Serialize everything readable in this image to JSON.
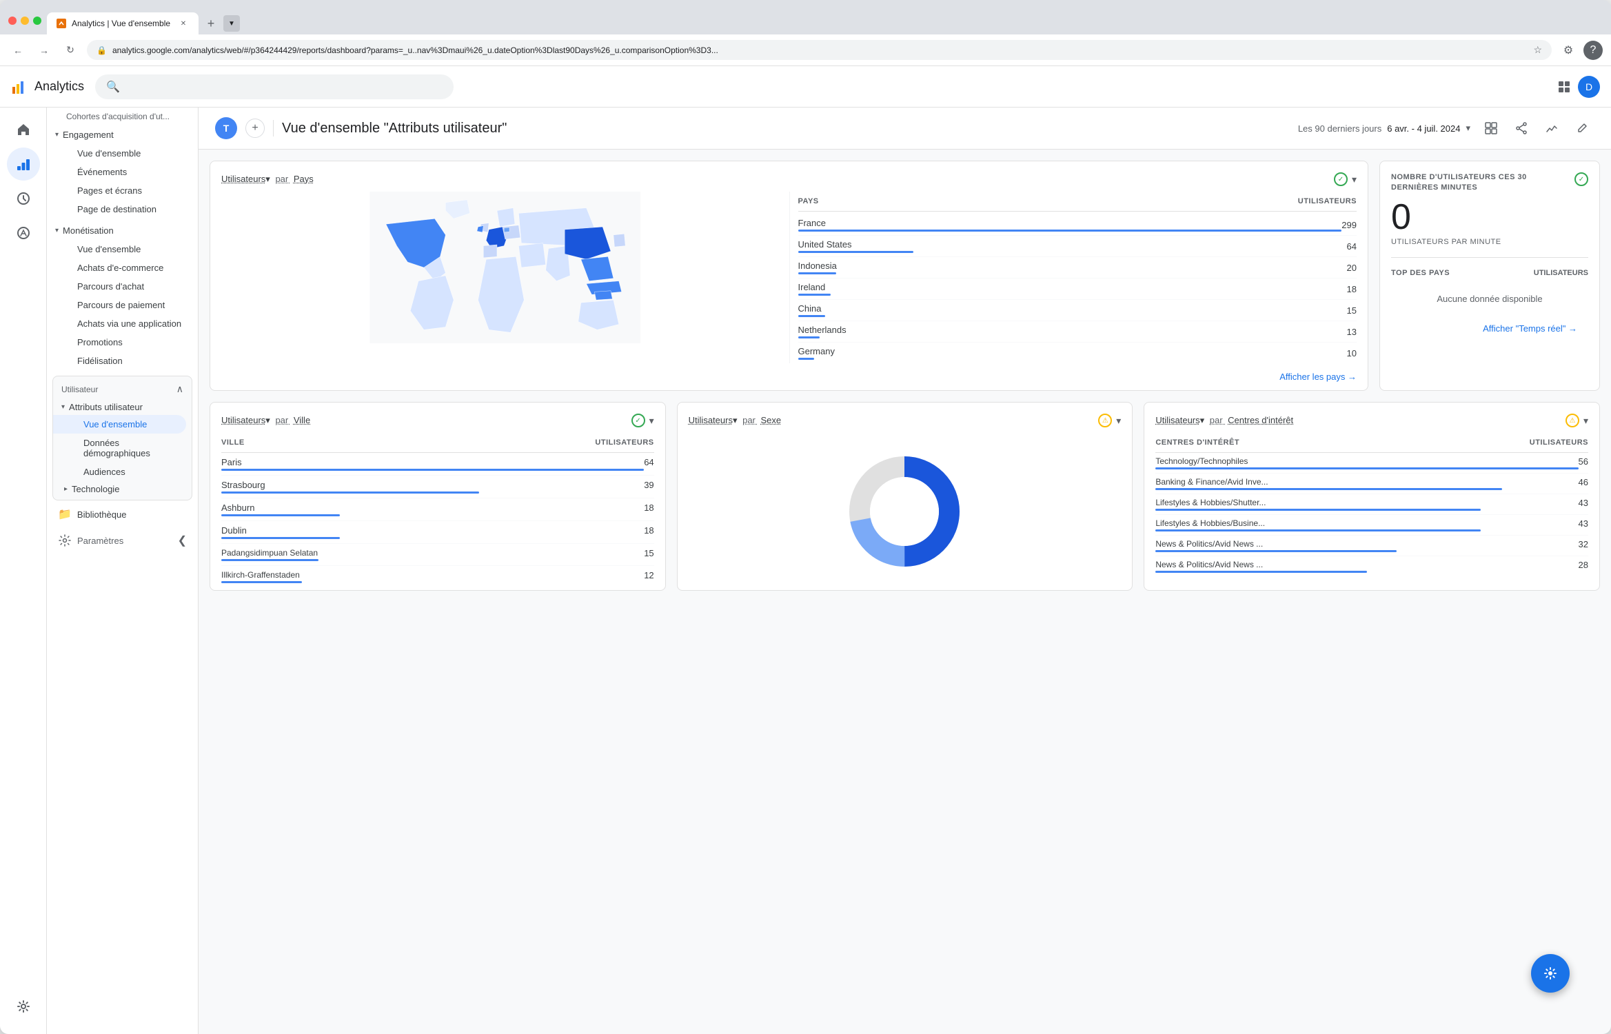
{
  "browser": {
    "tab_title": "Analytics | Vue d'ensemble",
    "url": "analytics.google.com/analytics/web/#/p364244429/reports/dashboard?params=_u..nav%3Dmaui%26_u.dateOption%3Dlast90Days%26_u.comparisonOption%3D3...",
    "tab_favicon": "📊"
  },
  "app": {
    "name": "Analytics",
    "search_placeholder": ""
  },
  "header": {
    "page_breadcrumb": "T",
    "page_title": "Vue d'ensemble \"Attributs utilisateur\"",
    "date_range_label": "Les 90 derniers jours",
    "date_range": "6 avr. - 4 juil. 2024"
  },
  "sidebar_icons": {
    "home": "🏠",
    "bar_chart": "📊",
    "target": "🎯",
    "antenna": "📡"
  },
  "sidebar": {
    "sections": [
      {
        "type": "category",
        "label": "Cohortes d'acquisition d'ut...",
        "indent": 0
      },
      {
        "type": "header",
        "label": "Engagement",
        "expanded": true
      },
      {
        "type": "item",
        "label": "Vue d'ensemble",
        "indent": 1
      },
      {
        "type": "item",
        "label": "Événements",
        "indent": 1
      },
      {
        "type": "item",
        "label": "Pages et écrans",
        "indent": 1
      },
      {
        "type": "item",
        "label": "Page de destination",
        "indent": 1
      },
      {
        "type": "header",
        "label": "Monétisation",
        "expanded": true
      },
      {
        "type": "item",
        "label": "Vue d'ensemble",
        "indent": 1
      },
      {
        "type": "item",
        "label": "Achats d'e-commerce",
        "indent": 1
      },
      {
        "type": "item",
        "label": "Parcours d'achat",
        "indent": 1
      },
      {
        "type": "item",
        "label": "Parcours de paiement",
        "indent": 1
      },
      {
        "type": "item",
        "label": "Achats via une application",
        "indent": 1
      },
      {
        "type": "item",
        "label": "Promotions",
        "indent": 1
      },
      {
        "type": "item",
        "label": "Fidélisation",
        "indent": 1
      },
      {
        "type": "section_box",
        "label": "Utilisateur"
      }
    ],
    "user_section": {
      "label": "Utilisateur",
      "subsections": [
        {
          "label": "Attributs utilisateur",
          "expanded": true,
          "items": [
            {
              "label": "Vue d'ensemble",
              "active": true
            },
            {
              "label": "Données démographiques"
            },
            {
              "label": "Audiences"
            }
          ]
        },
        {
          "label": "Technologie",
          "expanded": false,
          "items": []
        }
      ]
    },
    "library": "Bibliothèque",
    "settings": "⚙"
  },
  "cards": {
    "card1": {
      "title": "Utilisateurs",
      "title_metric": "par",
      "title_dimension": "Pays",
      "col1": "PAYS",
      "col2": "UTILISATEURS",
      "rows": [
        {
          "label": "France",
          "value": 299,
          "bar_pct": 100
        },
        {
          "label": "United States",
          "value": 64,
          "bar_pct": 21
        },
        {
          "label": "Indonesia",
          "value": 20,
          "bar_pct": 7
        },
        {
          "label": "Ireland",
          "value": 18,
          "bar_pct": 6
        },
        {
          "label": "China",
          "value": 15,
          "bar_pct": 5
        },
        {
          "label": "Netherlands",
          "value": 13,
          "bar_pct": 4
        },
        {
          "label": "Germany",
          "value": 10,
          "bar_pct": 3
        }
      ],
      "link": "Afficher les pays →"
    },
    "card2": {
      "title": "NOMBRE D'UTILISATEURS CES 30 DERNIÈRES MINUTES",
      "big_number": "0",
      "sub_label": "UTILISATEURS PAR MINUTE",
      "top_countries_label": "TOP DES PAYS",
      "top_countries_col": "UTILISATEURS",
      "no_data": "Aucune donnée disponible",
      "link": "Afficher \"Temps réel\" →"
    },
    "card3": {
      "title": "Utilisateurs",
      "title_metric": "par",
      "title_dimension": "Ville",
      "col1": "VILLE",
      "col2": "UTILISATEURS",
      "rows": [
        {
          "label": "Paris",
          "value": 64,
          "bar_pct": 100
        },
        {
          "label": "Strasbourg",
          "value": 39,
          "bar_pct": 61
        },
        {
          "label": "Ashburn",
          "value": 18,
          "bar_pct": 28
        },
        {
          "label": "Dublin",
          "value": 18,
          "bar_pct": 28
        },
        {
          "label": "Padangsidimpuan Selatan",
          "value": 15,
          "bar_pct": 23
        },
        {
          "label": "Illkirch-Graffenstaden",
          "value": 12,
          "bar_pct": 19
        }
      ]
    },
    "card4": {
      "title": "Utilisateurs",
      "title_metric": "par",
      "title_dimension": "Sexe",
      "donut": {
        "blue_pct": 75,
        "gray_pct": 25
      }
    },
    "card5": {
      "title": "Utilisateurs",
      "title_metric": "par",
      "title_dimension": "Centres d'intérêt",
      "col1": "CENTRES D'INTÉRÊT",
      "col2": "UTILISATEURS",
      "rows": [
        {
          "label": "Technology/Technophiles",
          "value": 56,
          "bar_pct": 100
        },
        {
          "label": "Banking & Finance/Avid Inve...",
          "value": 46,
          "bar_pct": 82
        },
        {
          "label": "Lifestyles & Hobbies/Shutter...",
          "value": 43,
          "bar_pct": 77
        },
        {
          "label": "Lifestyles & Hobbies/Busine...",
          "value": 43,
          "bar_pct": 77
        },
        {
          "label": "News & Politics/Avid News ...",
          "value": 32,
          "bar_pct": 57
        },
        {
          "label": "News & Politics/Avid News ...",
          "value": 28,
          "bar_pct": 50
        }
      ]
    }
  }
}
